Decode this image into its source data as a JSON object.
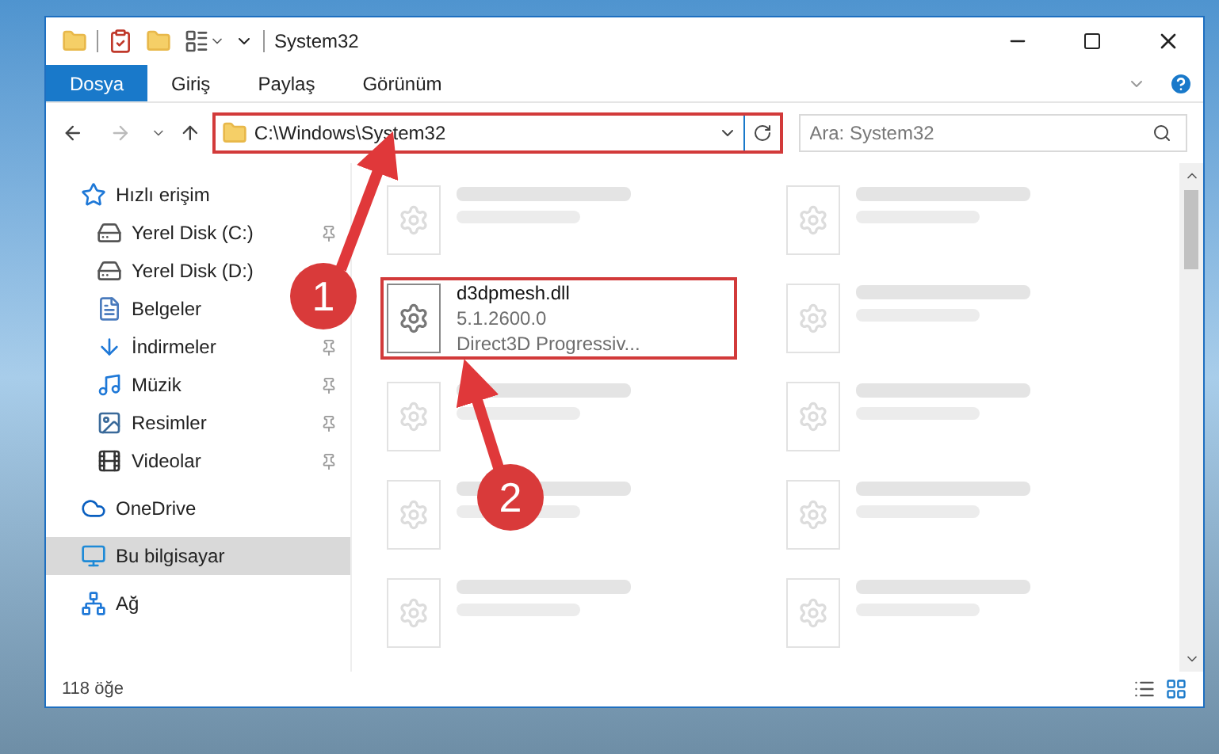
{
  "window": {
    "title": "System32"
  },
  "ribbon_tabs": [
    {
      "label": "Dosya",
      "selected": true
    },
    {
      "label": "Giriş",
      "selected": false
    },
    {
      "label": "Paylaş",
      "selected": false
    },
    {
      "label": "Görünüm",
      "selected": false
    }
  ],
  "address": {
    "path": "C:\\Windows\\System32",
    "highlighted": true
  },
  "search": {
    "placeholder": "Ara: System32"
  },
  "sidebar": {
    "items": [
      {
        "label": "Hızlı erişim",
        "kind": "star",
        "selected": false,
        "children": [
          {
            "label": "Yerel Disk (C:)",
            "kind": "drive",
            "pinned": true,
            "selected": false
          },
          {
            "label": "Yerel Disk (D:)",
            "kind": "drive",
            "selected": false
          },
          {
            "label": "Belgeler",
            "kind": "document",
            "selected": false
          },
          {
            "label": "İndirmeler",
            "kind": "download",
            "pinned": true,
            "selected": false
          },
          {
            "label": "Müzik",
            "kind": "music",
            "pinned": true,
            "selected": false
          },
          {
            "label": "Resimler",
            "kind": "picture",
            "pinned": true,
            "selected": false
          },
          {
            "label": "Videolar",
            "kind": "video",
            "pinned": true,
            "selected": false
          }
        ]
      },
      {
        "label": "OneDrive",
        "kind": "cloud",
        "selected": false
      },
      {
        "label": "Bu bilgisayar",
        "kind": "computer",
        "selected": true
      },
      {
        "label": "Ağ",
        "kind": "network",
        "selected": false
      }
    ]
  },
  "files": [
    {
      "kind": "blurred"
    },
    {
      "kind": "blurred"
    },
    {
      "kind": "file",
      "name": "d3dpmesh.dll",
      "details": [
        "5.1.2600.0",
        "Direct3D Progressiv..."
      ],
      "highlighted": true
    },
    {
      "kind": "blurred"
    },
    {
      "kind": "blurred"
    },
    {
      "kind": "blurred"
    },
    {
      "kind": "blurred"
    },
    {
      "kind": "blurred"
    },
    {
      "kind": "blurred"
    },
    {
      "kind": "blurred"
    }
  ],
  "status_bar": {
    "count": "118 öğe"
  },
  "annotations": [
    {
      "number": "1"
    },
    {
      "number": "2"
    }
  ]
}
